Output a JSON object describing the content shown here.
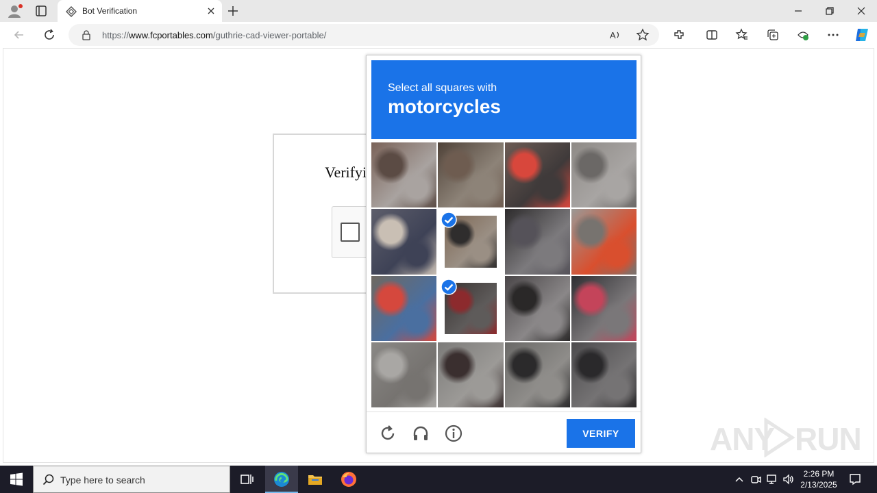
{
  "browser": {
    "tab_title": "Bot Verification",
    "url_scheme": "https://",
    "url_host": "www.fcportables.com",
    "url_path": "/guthrie-cad-viewer-portable/"
  },
  "page": {
    "verify_heading": "Verifyi"
  },
  "captcha": {
    "prompt": "Select all squares with",
    "object": "motorcycles",
    "tiles": [
      {
        "selected": false
      },
      {
        "selected": false
      },
      {
        "selected": false
      },
      {
        "selected": false
      },
      {
        "selected": false
      },
      {
        "selected": true
      },
      {
        "selected": false
      },
      {
        "selected": false
      },
      {
        "selected": false
      },
      {
        "selected": true
      },
      {
        "selected": false
      },
      {
        "selected": false
      },
      {
        "selected": false
      },
      {
        "selected": false
      },
      {
        "selected": false
      },
      {
        "selected": false
      }
    ],
    "verify_label": "VERIFY",
    "icons": [
      "refresh-icon",
      "headphones-icon",
      "info-icon"
    ],
    "accent_color": "#1a73e8"
  },
  "watermark": {
    "left": "ANY",
    "right": "RUN"
  },
  "taskbar": {
    "search_placeholder": "Type here to search",
    "time": "2:26 PM",
    "date": "2/13/2025"
  }
}
